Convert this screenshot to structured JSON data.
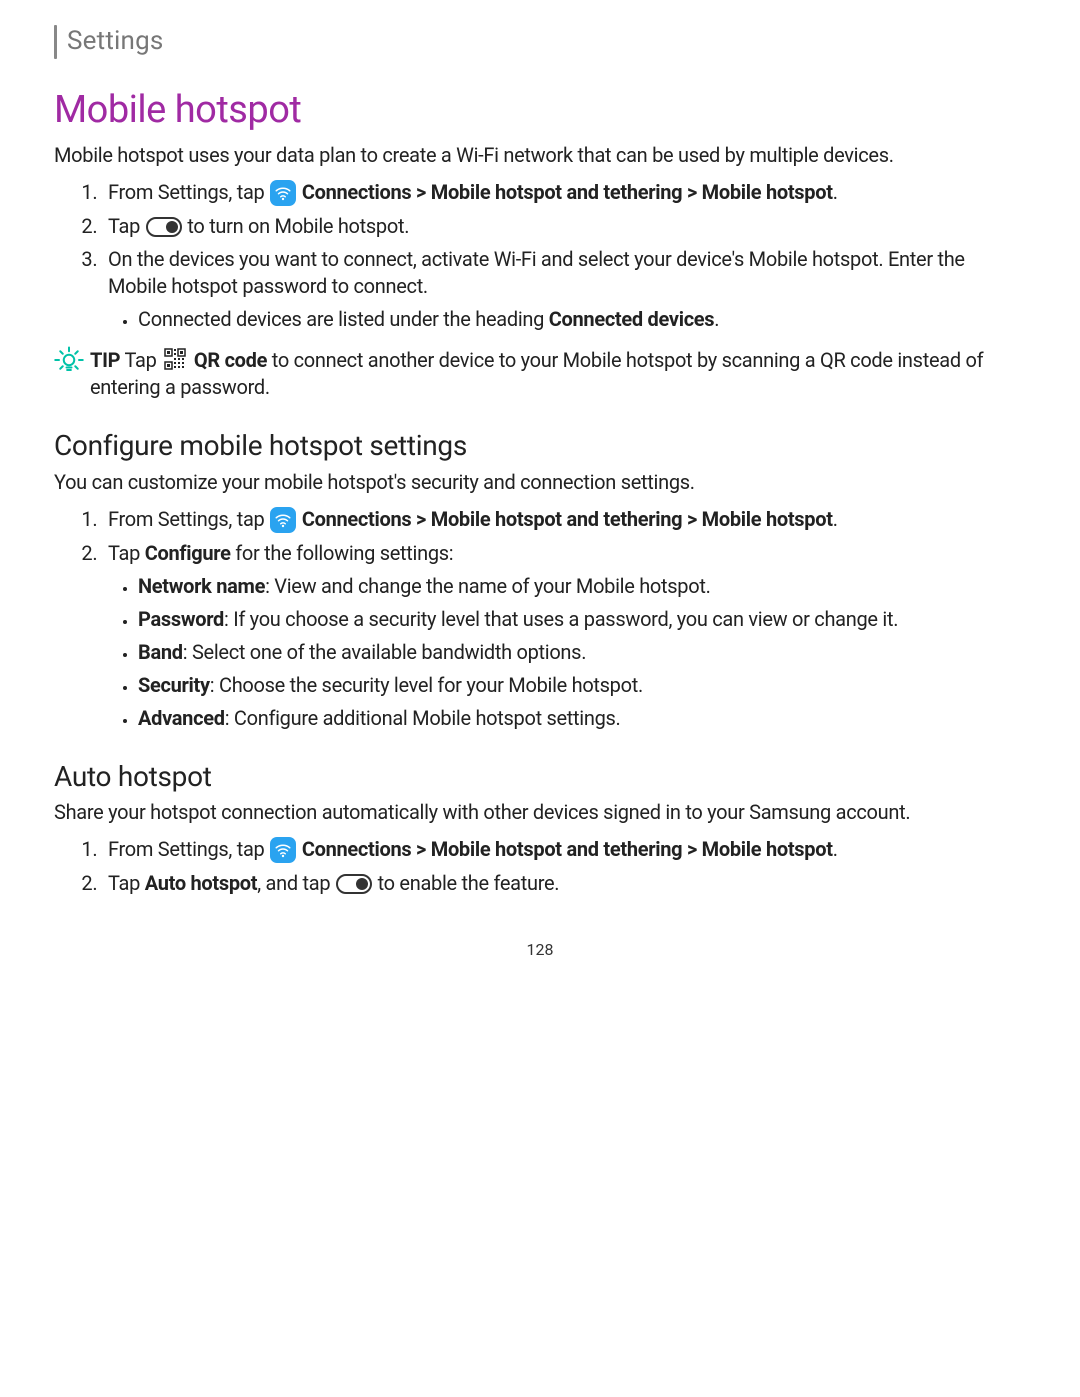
{
  "breadcrumb": "Settings",
  "title": "Mobile hotspot",
  "intro": "Mobile hotspot uses your data plan to create a Wi-Fi network that can be used by multiple devices.",
  "s1": {
    "step1_pre": "From Settings, tap ",
    "step1_bold": "Connections > Mobile hotspot and tethering > Mobile hotspot",
    "step1_post": ".",
    "step2_pre": "Tap ",
    "step2_post": " to turn on Mobile hotspot.",
    "step3": "On the devices you want to connect, activate Wi-Fi and select your device's Mobile hotspot. Enter the Mobile hotspot password to connect.",
    "step3_sub_pre": "Connected devices are listed under the heading ",
    "step3_sub_bold": "Connected devices",
    "step3_sub_post": "."
  },
  "tip": {
    "label": "TIP",
    "pre": " Tap ",
    "bold": "QR code",
    "post": " to connect another device to your Mobile hotspot by scanning a QR code instead of entering a password."
  },
  "config": {
    "heading": "Configure mobile hotspot settings",
    "desc": "You can customize your mobile hotspot's security and connection settings.",
    "step1_pre": "From Settings, tap ",
    "step1_bold": "Connections > Mobile hotspot and tethering > Mobile hotspot",
    "step1_post": ".",
    "step2_pre": "Tap ",
    "step2_bold": "Configure",
    "step2_post": " for the following settings:",
    "items": {
      "a_name": "Network name",
      "a_text": ": View and change the name of your Mobile hotspot.",
      "b_name": "Password",
      "b_text": ": If you choose a security level that uses a password, you can view or change it.",
      "c_name": "Band",
      "c_text": ": Select one of the available bandwidth options.",
      "d_name": "Security",
      "d_text": ": Choose the security level for your Mobile hotspot.",
      "e_name": "Advanced",
      "e_text": ": Configure additional Mobile hotspot settings."
    }
  },
  "auto": {
    "heading": "Auto hotspot",
    "desc": "Share your hotspot connection automatically with other devices signed in to your Samsung account.",
    "step1_pre": "From Settings, tap ",
    "step1_bold": "Connections > Mobile hotspot and tethering > Mobile hotspot",
    "step1_post": ".",
    "step2_pre": "Tap ",
    "step2_bold": "Auto hotspot",
    "step2_mid": ", and tap ",
    "step2_post": " to enable the feature."
  },
  "page_num": "128"
}
